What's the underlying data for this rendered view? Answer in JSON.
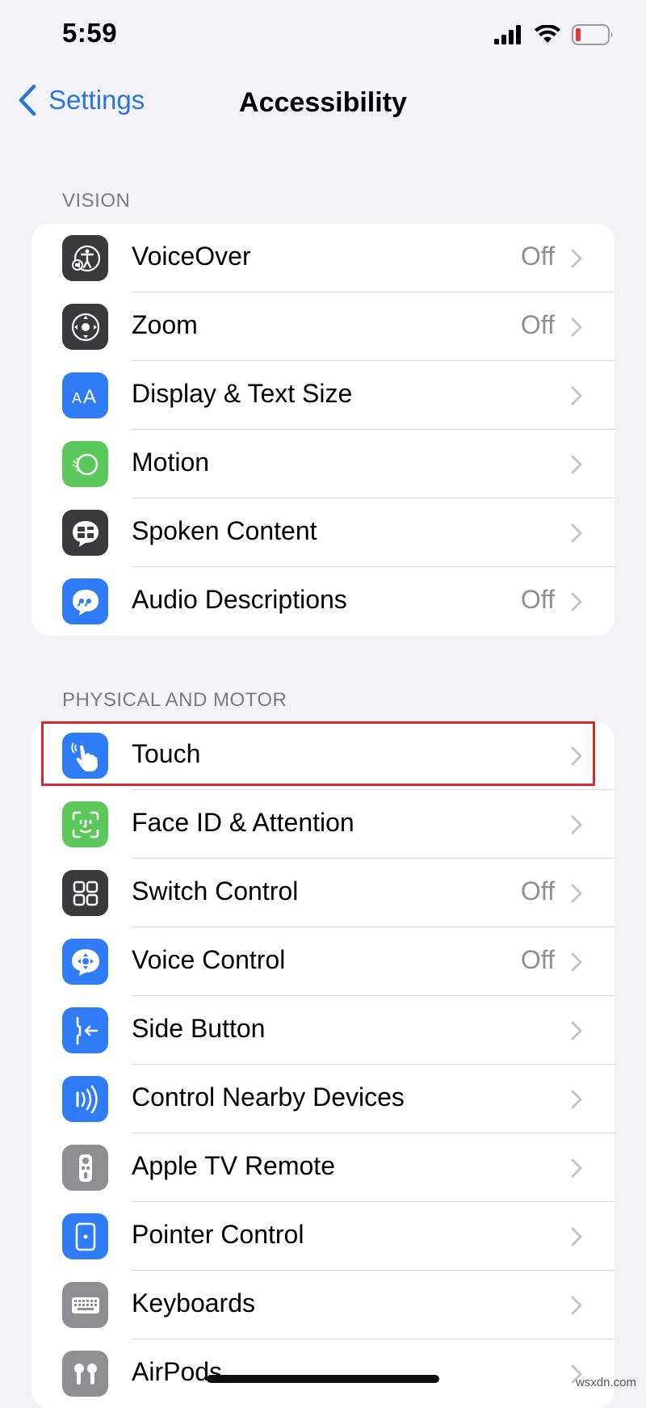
{
  "status_bar": {
    "time": "5:59"
  },
  "nav": {
    "back_label": "Settings",
    "title": "Accessibility"
  },
  "sections": [
    {
      "header": "VISION",
      "rows": [
        {
          "label": "VoiceOver",
          "value": "Off",
          "icon": "voiceover-icon",
          "icon_color": "#3a3a3c"
        },
        {
          "label": "Zoom",
          "value": "Off",
          "icon": "zoom-icon",
          "icon_color": "#3a3a3c"
        },
        {
          "label": "Display & Text Size",
          "value": "",
          "icon": "display-text-size-icon",
          "icon_color": "#2f7cf6"
        },
        {
          "label": "Motion",
          "value": "",
          "icon": "motion-icon",
          "icon_color": "#5cc85c"
        },
        {
          "label": "Spoken Content",
          "value": "",
          "icon": "spoken-content-icon",
          "icon_color": "#3a3a3c"
        },
        {
          "label": "Audio Descriptions",
          "value": "Off",
          "icon": "audio-descriptions-icon",
          "icon_color": "#2f7cf6"
        }
      ]
    },
    {
      "header": "PHYSICAL AND MOTOR",
      "rows": [
        {
          "label": "Touch",
          "value": "",
          "icon": "touch-icon",
          "icon_color": "#2f7cf6",
          "highlighted": true
        },
        {
          "label": "Face ID & Attention",
          "value": "",
          "icon": "face-id-icon",
          "icon_color": "#5cc85c"
        },
        {
          "label": "Switch Control",
          "value": "Off",
          "icon": "switch-control-icon",
          "icon_color": "#3a3a3c"
        },
        {
          "label": "Voice Control",
          "value": "Off",
          "icon": "voice-control-icon",
          "icon_color": "#2f7cf6"
        },
        {
          "label": "Side Button",
          "value": "",
          "icon": "side-button-icon",
          "icon_color": "#2f7cf6"
        },
        {
          "label": "Control Nearby Devices",
          "value": "",
          "icon": "nearby-devices-icon",
          "icon_color": "#2f7cf6"
        },
        {
          "label": "Apple TV Remote",
          "value": "",
          "icon": "apple-tv-remote-icon",
          "icon_color": "#8e8e93"
        },
        {
          "label": "Pointer Control",
          "value": "",
          "icon": "pointer-control-icon",
          "icon_color": "#2f7cf6"
        },
        {
          "label": "Keyboards",
          "value": "",
          "icon": "keyboard-icon",
          "icon_color": "#8e8e93"
        },
        {
          "label": "AirPods",
          "value": "",
          "icon": "airpods-icon",
          "icon_color": "#8e8e93"
        }
      ]
    }
  ],
  "colors": {
    "accent": "#2a74dc",
    "battery_low": "#e5383b",
    "highlight": "#d32b2b"
  },
  "watermark": "wsxdn.com"
}
